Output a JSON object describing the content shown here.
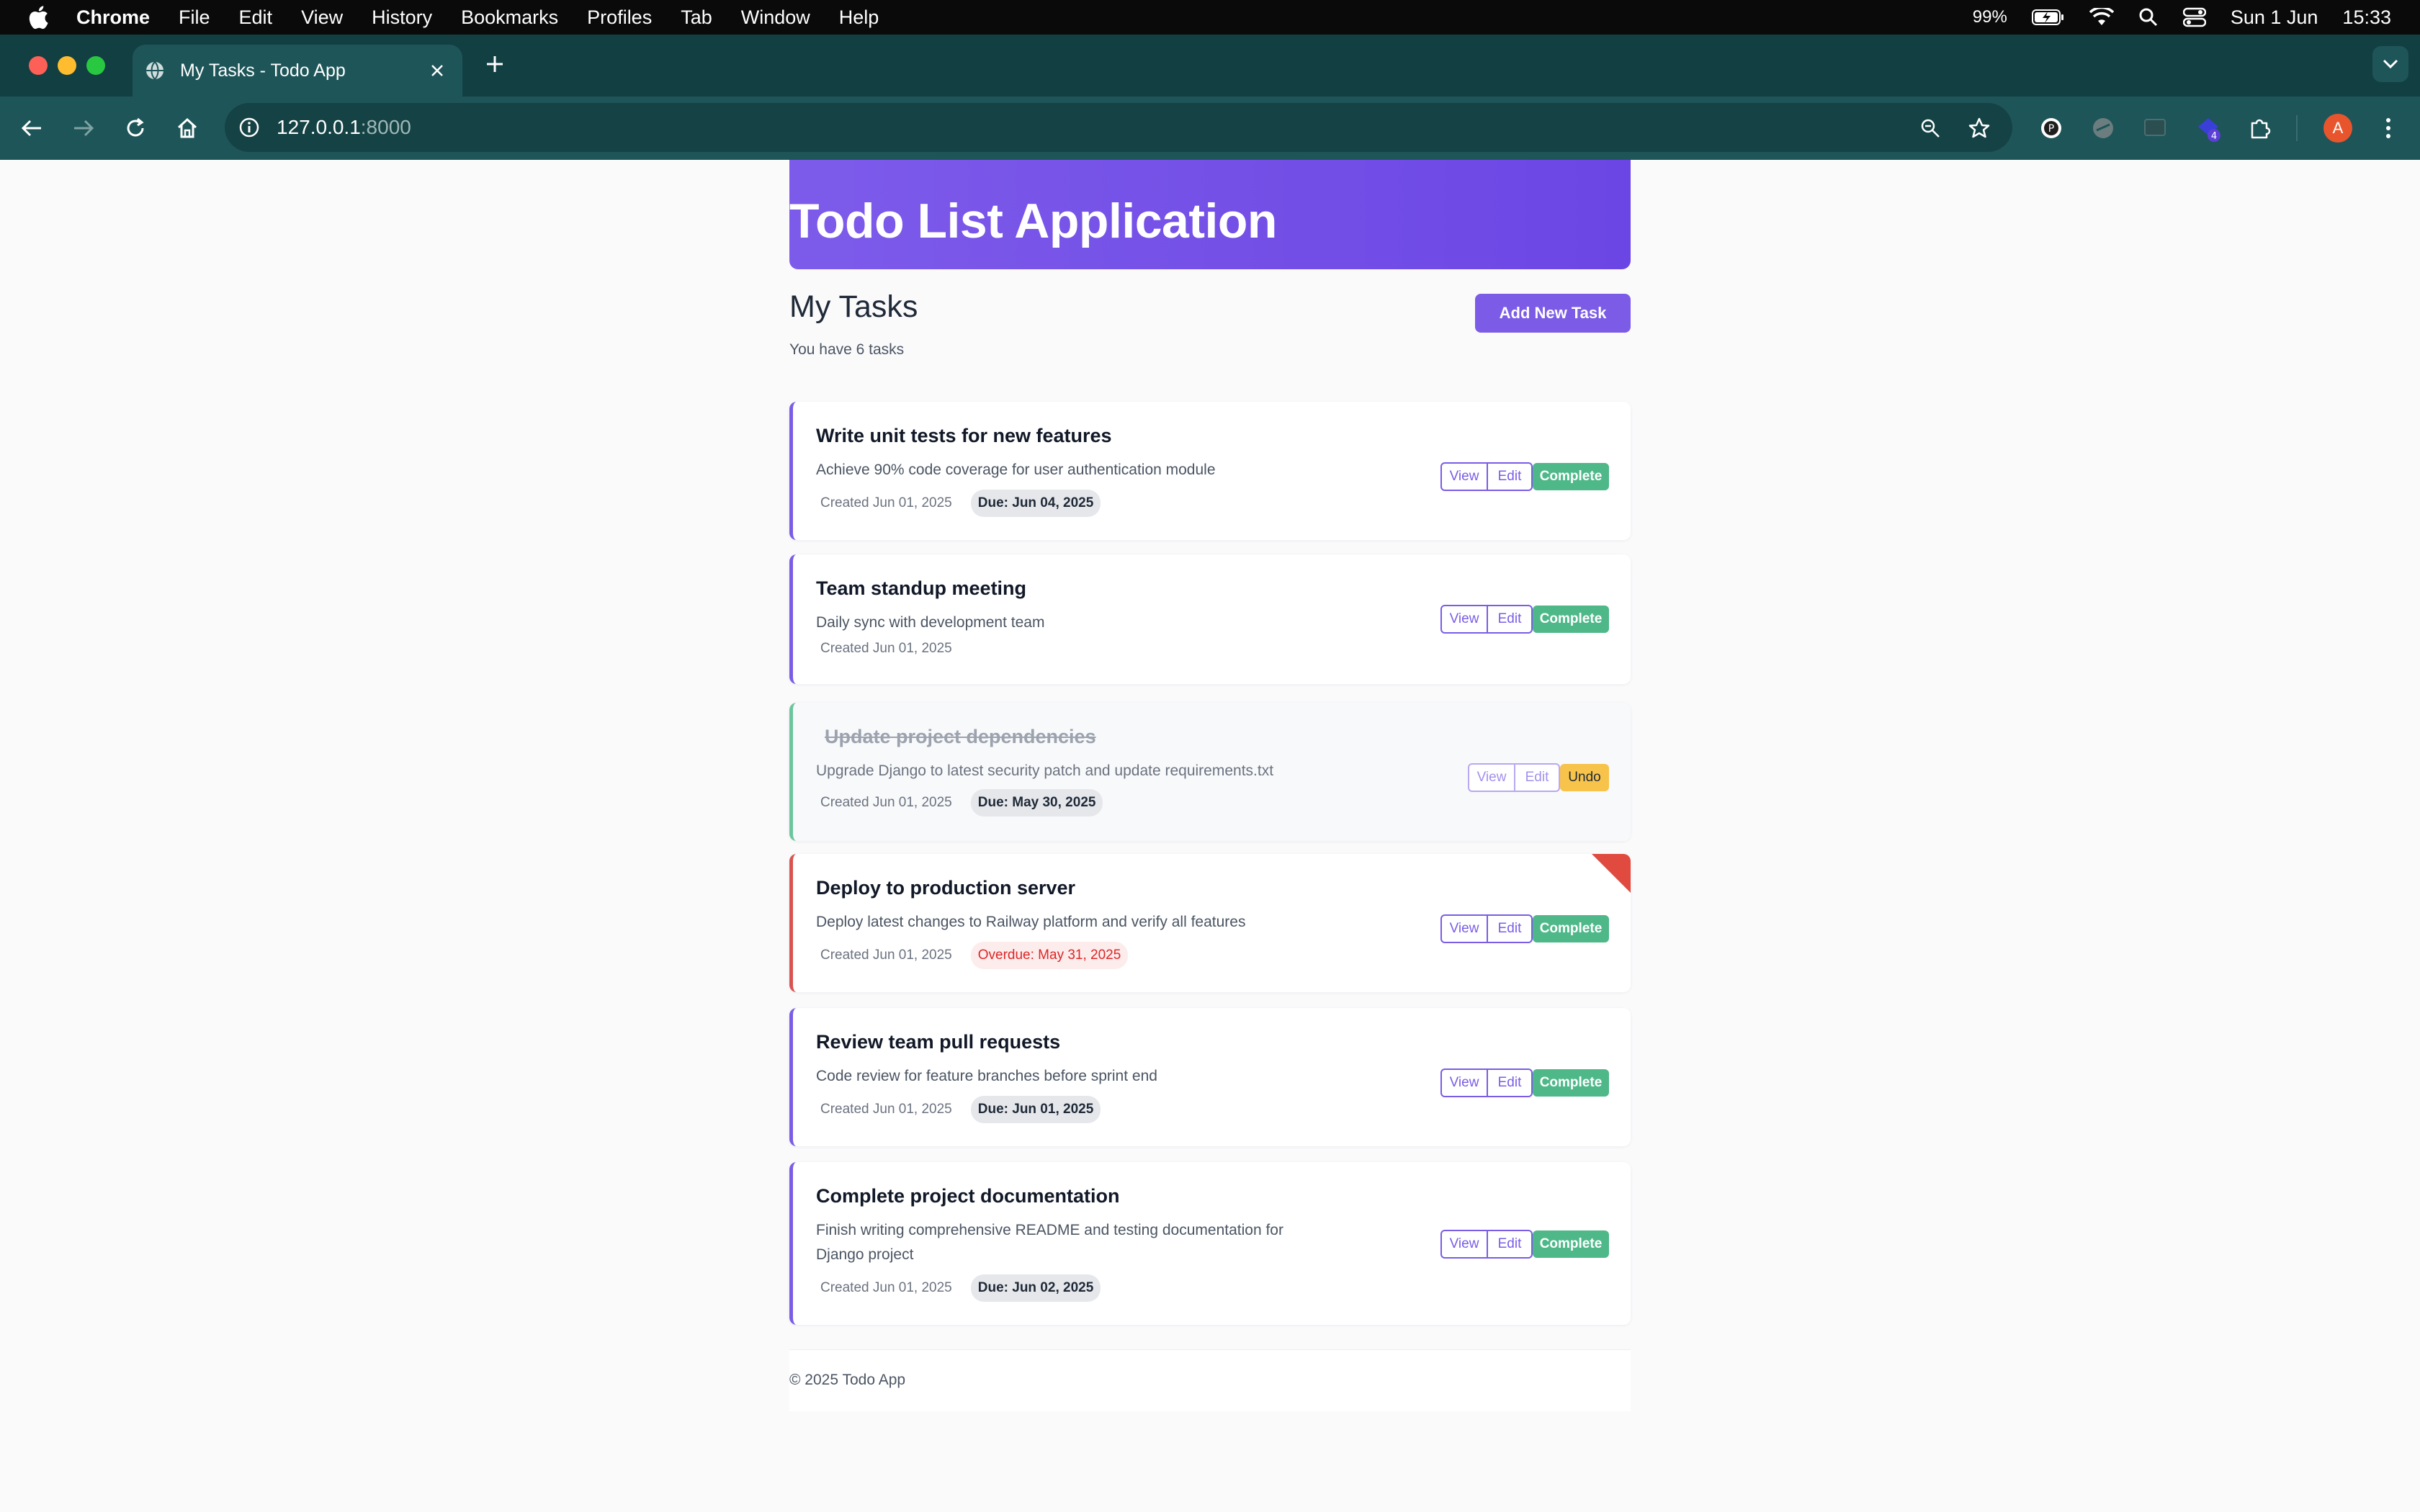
{
  "menubar": {
    "app": "Chrome",
    "items": [
      "File",
      "Edit",
      "View",
      "History",
      "Bookmarks",
      "Profiles",
      "Tab",
      "Window",
      "Help"
    ],
    "battery": "99%",
    "date": "Sun 1 Jun",
    "time": "15:33"
  },
  "browser": {
    "tab_title": "My Tasks - Todo App",
    "url_host": "127.0.0.1",
    "url_port": ":8000",
    "extension_badge": "4",
    "avatar_letter": "A"
  },
  "page": {
    "hero_title": "Todo List Application",
    "heading": "My Tasks",
    "count_text": "You have 6 tasks",
    "add_button": "Add New Task",
    "footer": "© 2025 Todo App"
  },
  "labels": {
    "view": "View",
    "edit": "Edit",
    "complete": "Complete",
    "undo": "Undo"
  },
  "tasks": [
    {
      "title": "Write unit tests for new features",
      "description": "Achieve 90% code coverage for user authentication module",
      "created": "Created Jun 01, 2025",
      "due": "Due: Jun 04, 2025",
      "status": "active"
    },
    {
      "title": "Team standup meeting",
      "description": "Daily sync with development team",
      "created": "Created Jun 01, 2025",
      "due": "",
      "status": "active"
    },
    {
      "title": "Update project dependencies",
      "description": "Upgrade Django to latest security patch and update requirements.txt",
      "created": "Created Jun 01, 2025",
      "due": "Due: May 30, 2025",
      "status": "completed"
    },
    {
      "title": "Deploy to production server",
      "description": "Deploy latest changes to Railway platform and verify all features",
      "created": "Created Jun 01, 2025",
      "due": "Overdue: May 31, 2025",
      "status": "overdue"
    },
    {
      "title": "Review team pull requests",
      "description": "Code review for feature branches before sprint end",
      "created": "Created Jun 01, 2025",
      "due": "Due: Jun 01, 2025",
      "status": "active"
    },
    {
      "title": "Complete project documentation",
      "description": "Finish writing comprehensive README and testing documentation for Django project",
      "created": "Created Jun 01, 2025",
      "due": "Due: Jun 02, 2025",
      "status": "active"
    }
  ],
  "colors": {
    "accent": "#7c5ce6",
    "complete": "#4fb889",
    "undo": "#f7c34a",
    "overdue": "#e04a3f",
    "done_border": "#6cc59d"
  }
}
